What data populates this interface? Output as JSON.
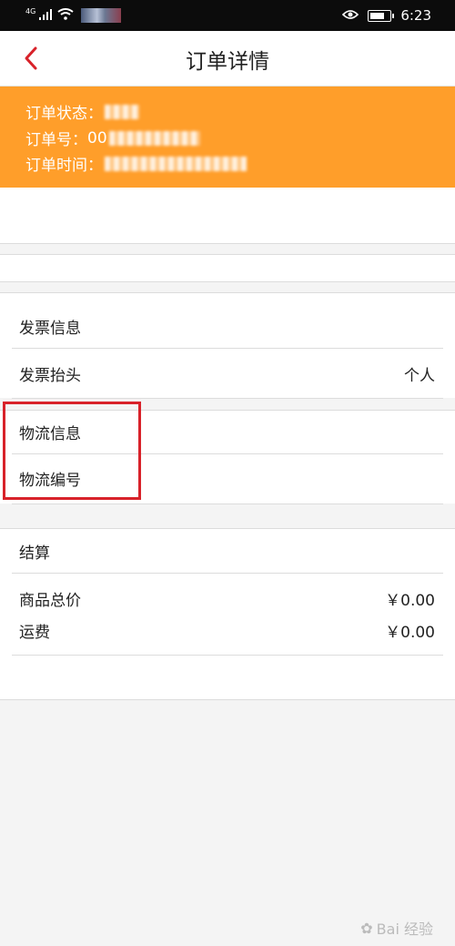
{
  "status_bar": {
    "network": "4G",
    "time": "6:23"
  },
  "nav": {
    "title": "订单详情"
  },
  "order": {
    "status_label": "订单状态：",
    "number_label": "订单号：",
    "number_visible_prefix": "00",
    "time_label": "订单时间："
  },
  "invoice": {
    "section_title": "发票信息",
    "header_label": "发票抬头",
    "header_value": "个人"
  },
  "logistics": {
    "section_title": "物流信息",
    "number_label": "物流编号"
  },
  "settlement": {
    "section_title": "结算",
    "items": [
      {
        "label": "商品总价",
        "value": "￥0.00"
      },
      {
        "label": "运费",
        "value": "￥0.00"
      }
    ]
  },
  "watermark": {
    "text": "Bai 经验"
  },
  "colors": {
    "accent_orange": "#ff9e2a",
    "back_red": "#d8222a",
    "highlight_red": "#d8222a"
  }
}
